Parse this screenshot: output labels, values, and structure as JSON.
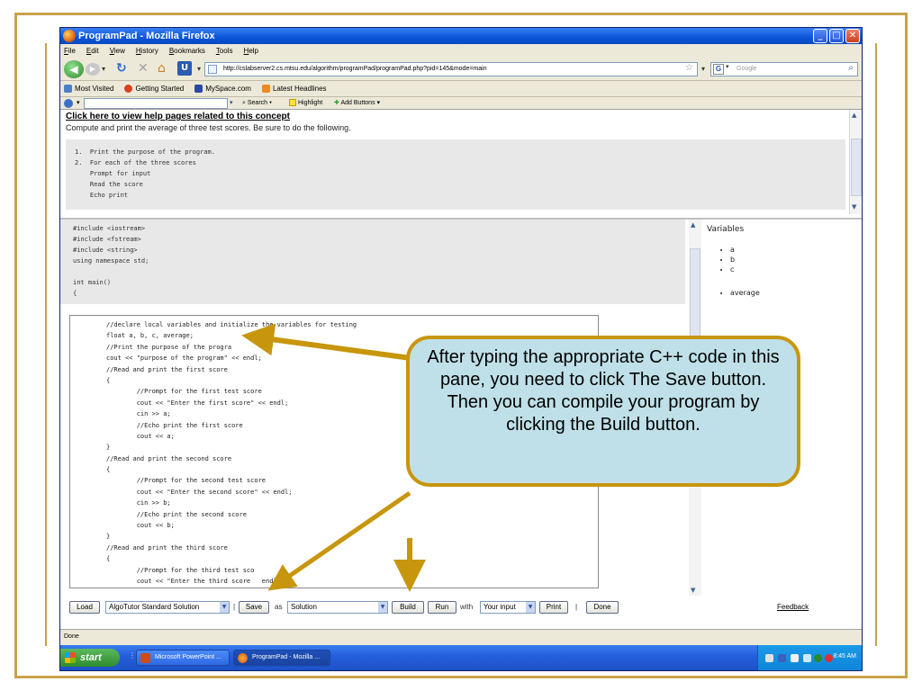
{
  "window": {
    "title": "ProgramPad - Mozilla Firefox",
    "controls": {
      "minimize": "_",
      "maximize": "□",
      "close": "✕"
    }
  },
  "menu": [
    "File",
    "Edit",
    "View",
    "History",
    "Bookmarks",
    "Tools",
    "Help"
  ],
  "nav": {
    "url": "http://cslabserver2.cs.mtsu.edu/algorithm/programPad/programPad.php?pid=145&mode=main",
    "search_placeholder": "Google"
  },
  "bookmarks": [
    "Most Visited",
    "Getting Started",
    "MySpace.com",
    "Latest Headlines"
  ],
  "toolbar2": {
    "search": "Search",
    "highlight": "Highlight",
    "add_buttons": "Add Buttons"
  },
  "task": {
    "help_link": "Click here to view help pages related to this concept",
    "description": "Compute and print the average of three test scores. Be sure to do the following.",
    "steps": [
      "1.  Print the purpose of the program.",
      "2.  For each of the three scores",
      "    Prompt for input",
      "    Read the score",
      "    Echo print"
    ]
  },
  "preamble_code": [
    "#include <iostream>",
    "#include <fstream>",
    "#include <string>",
    "using namespace std;",
    "",
    "int main()",
    "{"
  ],
  "variables": {
    "title": "Variables",
    "items": [
      "a",
      "b",
      "c"
    ],
    "items2": [
      "average"
    ]
  },
  "editor_code": [
    "//declare local variables and initialize the variables for testing",
    "float a, b, c, average;",
    "//Print the purpose of the progra",
    "cout << \"purpose of the program\" << endl;",
    "//Read and print the first score",
    "{",
    "        //Prompt for the first test score",
    "        cout << \"Enter the first score\" << endl;",
    "        cin >> a;",
    "        //Echo print the first score",
    "        cout << a;",
    "}",
    "//Read and print the second score",
    "{",
    "        //Prompt for the second test score",
    "        cout << \"Enter the second score\" << endl;",
    "        cin >> b;",
    "        //Echo print the second score",
    "        cout << b;",
    "}",
    "//Read and print the third score",
    "{",
    "        //Prompt for the third test sco",
    "        cout << \"Enter the third score   endl;"
  ],
  "bottom_bar": {
    "load": "Load",
    "solution_select": "AlgoTutor Standard Solution",
    "sep1": "|",
    "save": "Save",
    "as": "as",
    "as_select": "Solution",
    "build": "Build",
    "run": "Run",
    "with": "with",
    "input_select": "Your input",
    "print": "Print",
    "sep2": "|",
    "done": "Done",
    "feedback": "Feedback"
  },
  "status": "Done",
  "taskbar": {
    "start": "start",
    "items": [
      "Microsoft PowerPoint ...",
      "ProgramPad - Mozilla ..."
    ],
    "time": "8:45 AM"
  },
  "callout": {
    "text": "After typing the appropriate C++ code in this pane, you need to click The Save button.  Then you can compile your program by clicking the Build button."
  },
  "colors": {
    "frame": "#c8a24a",
    "arrow": "#c8960c",
    "callout_fill": "#bfe0e8"
  }
}
